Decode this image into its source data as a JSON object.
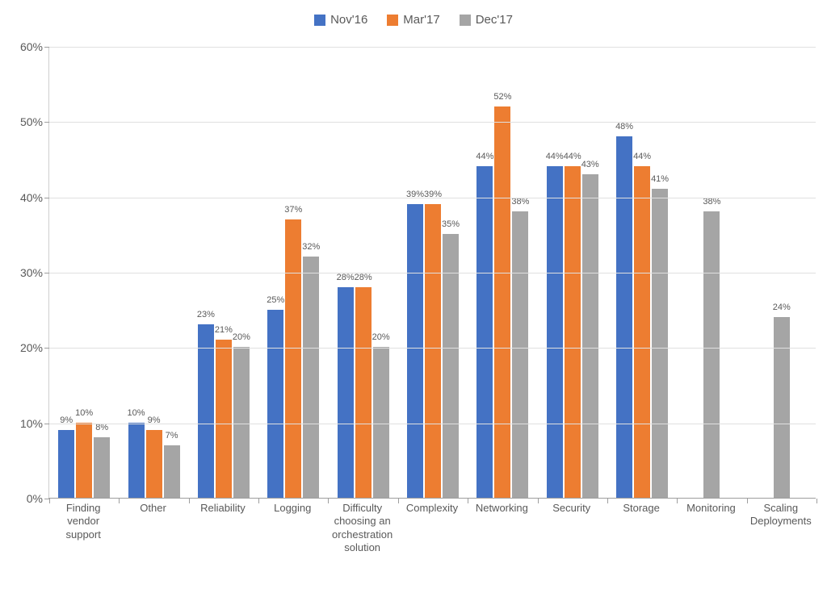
{
  "chart_data": {
    "type": "bar",
    "title": "",
    "xlabel": "",
    "ylabel": "",
    "ylim": [
      0,
      60
    ],
    "y_ticks": [
      0,
      10,
      20,
      30,
      40,
      50,
      60
    ],
    "y_tick_labels": [
      "0%",
      "10%",
      "20%",
      "30%",
      "40%",
      "50%",
      "60%"
    ],
    "y_format": "percent",
    "categories": [
      "Finding vendor support",
      "Other",
      "Reliability",
      "Logging",
      "Difficulty choosing an orchestration solution",
      "Complexity",
      "Networking",
      "Security",
      "Storage",
      "Monitoring",
      "Scaling Deployments"
    ],
    "series": [
      {
        "name": "Nov'16",
        "color": "#4472C4",
        "values": [
          9,
          10,
          23,
          25,
          28,
          39,
          44,
          44,
          48,
          null,
          null
        ]
      },
      {
        "name": "Mar'17",
        "color": "#ED7D31",
        "values": [
          10,
          9,
          21,
          37,
          28,
          39,
          52,
          44,
          44,
          null,
          null
        ]
      },
      {
        "name": "Dec'17",
        "color": "#A5A5A5",
        "values": [
          8,
          7,
          20,
          32,
          20,
          35,
          38,
          43,
          41,
          38,
          24
        ]
      }
    ],
    "grid": {
      "y": true,
      "x": false
    },
    "legend_position": "top"
  }
}
